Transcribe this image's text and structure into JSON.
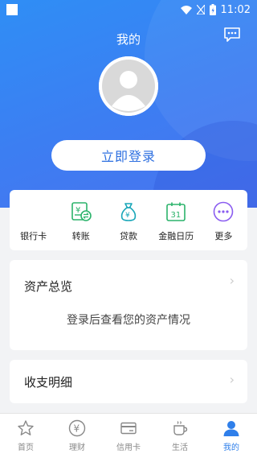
{
  "status": {
    "time": "11:02"
  },
  "header": {
    "title": "我的"
  },
  "login": {
    "button_label": "立即登录"
  },
  "quick_actions": [
    {
      "label": "银行卡",
      "icon": "bank-card-icon"
    },
    {
      "label": "转账",
      "icon": "transfer-icon"
    },
    {
      "label": "贷款",
      "icon": "loan-bag-icon"
    },
    {
      "label": "金融日历",
      "icon": "calendar-icon",
      "day": "31"
    },
    {
      "label": "更多",
      "icon": "more-icon"
    }
  ],
  "assets": {
    "title": "资产总览",
    "hint": "登录后查看您的资产情况"
  },
  "ledger": {
    "title": "收支明细"
  },
  "tabs": [
    {
      "label": "首页",
      "icon": "star-icon"
    },
    {
      "label": "理财",
      "icon": "yen-coin-icon"
    },
    {
      "label": "信用卡",
      "icon": "credit-card-icon"
    },
    {
      "label": "生活",
      "icon": "coffee-cup-icon"
    },
    {
      "label": "我的",
      "icon": "person-icon",
      "active": true
    }
  ],
  "colors": {
    "primary": "#3d7df2",
    "active_tab": "#2f7fea",
    "green": "#2bb36b",
    "teal": "#18a6b8",
    "purple": "#8a5cf0"
  }
}
